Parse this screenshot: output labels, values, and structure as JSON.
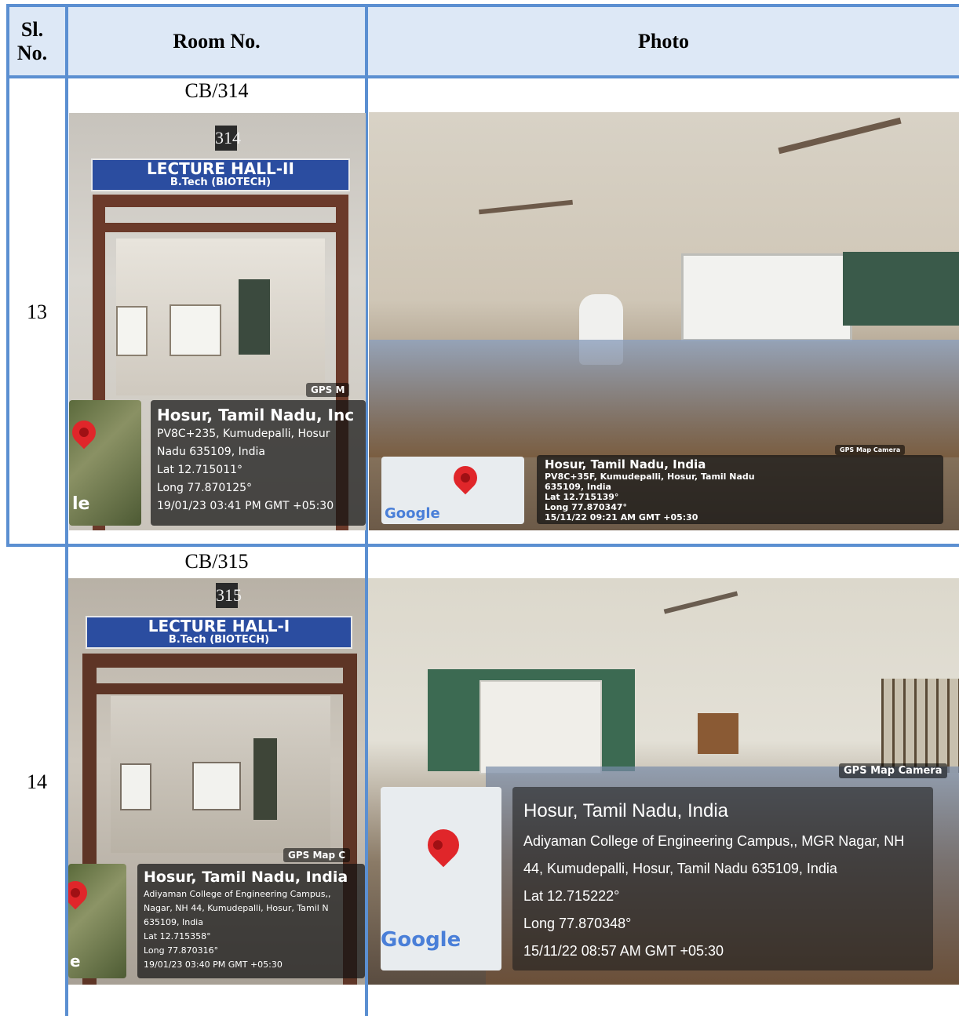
{
  "table": {
    "headers": {
      "sl_no": "Sl. No.",
      "room_no": "Room No.",
      "photo": "Photo"
    },
    "rows": [
      {
        "sl_no": "13",
        "room_no": "CB/314",
        "door_photo": {
          "room_number_plate": "314",
          "sign_title": "LECTURE HALL-II",
          "sign_subtitle": "B.Tech (BIOTECH)",
          "gps_tag": "GPS M",
          "overlay": {
            "title": "Hosur, Tamil Nadu, Inc",
            "line1": "PV8C+235, Kumudepalli, Hosur",
            "line2": "Nadu 635109, India",
            "lat": "Lat 12.715011°",
            "long": "Long 77.870125°",
            "datetime": "19/01/23 03:41 PM GMT +05:30"
          },
          "map_logo": "le"
        },
        "class_photo": {
          "gps_tag": "GPS Map Camera",
          "overlay": {
            "title": "Hosur, Tamil Nadu, India",
            "line1": "PV8C+35F, Kumudepalli, Hosur, Tamil Nadu",
            "line2": "635109, India",
            "lat": "Lat 12.715139°",
            "long": "Long 77.870347°",
            "datetime": "15/11/22 09:21 AM GMT +05:30"
          },
          "map_logo": "Google"
        }
      },
      {
        "sl_no": "14",
        "room_no": "CB/315",
        "door_photo": {
          "room_number_plate": "315",
          "sign_title": "LECTURE HALL-I",
          "sign_subtitle": "B.Tech (BIOTECH)",
          "gps_tag": "GPS Map C",
          "overlay": {
            "title": "Hosur, Tamil Nadu, India",
            "line1": "Adiyaman College of Engineering Campus,,",
            "line2": "Nagar, NH 44, Kumudepalli, Hosur, Tamil N",
            "line3": "635109, India",
            "lat": "Lat 12.715358°",
            "long": "Long 77.870316°",
            "datetime": "19/01/23 03:40 PM GMT +05:30"
          },
          "map_logo": "e"
        },
        "class_photo": {
          "gps_tag": "GPS Map Camera",
          "overlay": {
            "title": "Hosur, Tamil Nadu, India",
            "line1": "Adiyaman College of Engineering Campus,, MGR Nagar, NH",
            "line2": "44, Kumudepalli, Hosur, Tamil Nadu 635109, India",
            "lat": "Lat 12.715222°",
            "long": "Long 77.870348°",
            "datetime": "15/11/22 08:57 AM GMT +05:30"
          },
          "map_logo": "Google"
        }
      }
    ]
  },
  "colors": {
    "border": "#5b8fd1",
    "header_bg": "#dde8f6"
  }
}
